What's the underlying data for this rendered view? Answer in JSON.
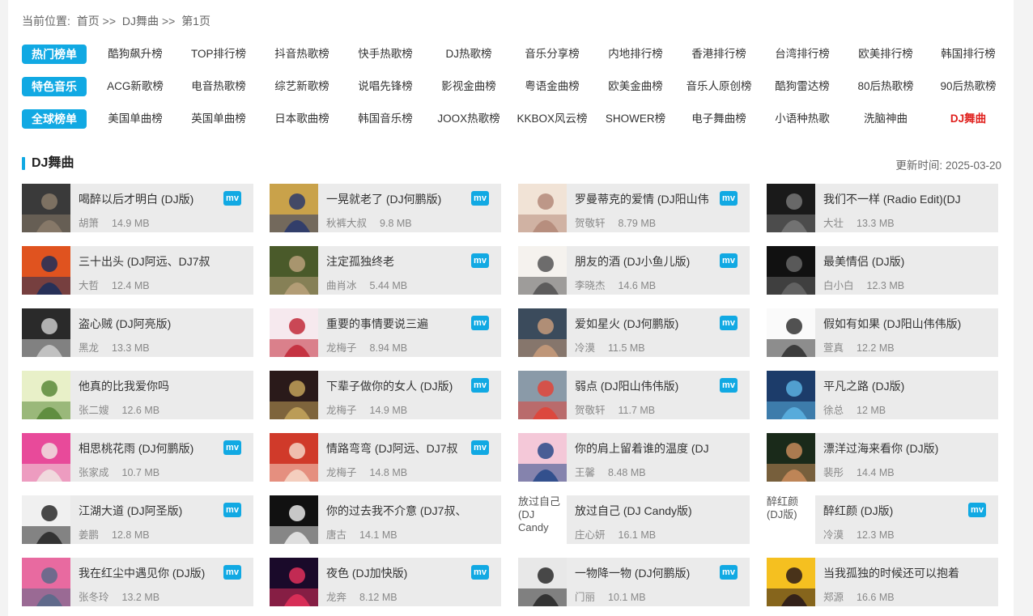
{
  "breadcrumb": {
    "prefix": "当前位置:",
    "home": "首页",
    "sep1": ">>",
    "section": "DJ舞曲",
    "sep2": ">>",
    "page": "第1页"
  },
  "categories": [
    {
      "badge": "热门榜单",
      "items": [
        "酷狗飙升榜",
        "TOP排行榜",
        "抖音热歌榜",
        "快手热歌榜",
        "DJ热歌榜",
        "音乐分享榜",
        "内地排行榜",
        "香港排行榜",
        "台湾排行榜",
        "欧美排行榜",
        "韩国排行榜"
      ]
    },
    {
      "badge": "特色音乐",
      "items": [
        "ACG新歌榜",
        "电音热歌榜",
        "综艺新歌榜",
        "说唱先锋榜",
        "影视金曲榜",
        "粤语金曲榜",
        "欧美金曲榜",
        "音乐人原创榜",
        "酷狗雷达榜",
        "80后热歌榜",
        "90后热歌榜"
      ]
    },
    {
      "badge": "全球榜单",
      "items": [
        "美国单曲榜",
        "英国单曲榜",
        "日本歌曲榜",
        "韩国音乐榜",
        "JOOX热歌榜",
        "KKBOX风云榜",
        "SHOWER榜",
        "电子舞曲榜",
        "小语种热歌",
        "洗脑神曲",
        "DJ舞曲"
      ]
    }
  ],
  "active_category": "DJ舞曲",
  "section": {
    "title": "DJ舞曲",
    "update_label": "更新时间:",
    "update_date": "2025-03-20"
  },
  "mv_label": "mv",
  "colors": {
    "accent": "#11a9e3",
    "active": "#e0201d",
    "card_bg": "#ebebeb"
  },
  "songs": [
    {
      "title": "喝醉以后才明白 (DJ版)",
      "artist": "胡箫",
      "size": "14.9 MB",
      "mv": true
    },
    {
      "title": "一晃就老了 (DJ何鹏版)",
      "artist": "秋裤大叔",
      "size": "9.8 MB",
      "mv": true
    },
    {
      "title": "罗曼蒂克的爱情 (DJ阳山伟",
      "artist": "贺敬轩",
      "size": "8.79 MB",
      "mv": true
    },
    {
      "title": "我们不一样 (Radio Edit)(DJ",
      "artist": "大壮",
      "size": "13.3 MB",
      "mv": false
    },
    {
      "title": "三十出头 (DJ阿远、DJ7叔",
      "artist": "大哲",
      "size": "12.4 MB",
      "mv": false
    },
    {
      "title": "注定孤独终老",
      "artist": "曲肖冰",
      "size": "5.44 MB",
      "mv": true
    },
    {
      "title": "朋友的酒 (DJ小鱼儿版)",
      "artist": "李晓杰",
      "size": "14.6 MB",
      "mv": true
    },
    {
      "title": "最美情侣 (DJ版)",
      "artist": "白小白",
      "size": "12.3 MB",
      "mv": false
    },
    {
      "title": "盗心贼 (DJ阿亮版)",
      "artist": "黑龙",
      "size": "13.3 MB",
      "mv": false
    },
    {
      "title": "重要的事情要说三遍",
      "artist": "龙梅子",
      "size": "8.94 MB",
      "mv": true
    },
    {
      "title": "爱如星火 (DJ何鹏版)",
      "artist": "冷漠",
      "size": "11.5 MB",
      "mv": true
    },
    {
      "title": "假如有如果 (DJ阳山伟伟版)",
      "artist": "萱真",
      "size": "12.2 MB",
      "mv": false
    },
    {
      "title": "他真的比我爱你吗",
      "artist": "张二嫂",
      "size": "12.6 MB",
      "mv": false
    },
    {
      "title": "下辈子做你的女人 (DJ版)",
      "artist": "龙梅子",
      "size": "14.9 MB",
      "mv": true
    },
    {
      "title": "弱点 (DJ阳山伟伟版)",
      "artist": "贺敬轩",
      "size": "11.7 MB",
      "mv": true
    },
    {
      "title": "平凡之路 (DJ版)",
      "artist": "徐总",
      "size": "12 MB",
      "mv": false
    },
    {
      "title": "相思桃花雨 (DJ何鹏版)",
      "artist": "张家成",
      "size": "10.7 MB",
      "mv": true
    },
    {
      "title": "情路弯弯 (DJ阿远、DJ7叔",
      "artist": "龙梅子",
      "size": "14.8 MB",
      "mv": true
    },
    {
      "title": "你的肩上留着谁的温度 (DJ",
      "artist": "王馨",
      "size": "8.48 MB",
      "mv": false
    },
    {
      "title": "漂洋过海来看你 (DJ版)",
      "artist": "裴彤",
      "size": "14.4 MB",
      "mv": false
    },
    {
      "title": "江湖大道 (DJ阿圣版)",
      "artist": "姜鹏",
      "size": "12.8 MB",
      "mv": true
    },
    {
      "title": "你的过去我不介意 (DJ7叔、",
      "artist": "唐古",
      "size": "14.1 MB",
      "mv": false
    },
    {
      "title": "放过自己 (DJ Candy版)",
      "artist": "庄心妍",
      "size": "16.1 MB",
      "mv": false,
      "broken_cover": "放过自己 (DJ Candy"
    },
    {
      "title": "醉红颜 (DJ版)",
      "artist": "冷漠",
      "size": "12.3 MB",
      "mv": true,
      "broken_cover": "醉红颜 (DJ版)"
    },
    {
      "title": "我在红尘中遇见你 (DJ版)",
      "artist": "张冬玲",
      "size": "13.2 MB",
      "mv": true
    },
    {
      "title": "夜色 (DJ加快版)",
      "artist": "龙奔",
      "size": "8.12 MB",
      "mv": true
    },
    {
      "title": "一物降一物 (DJ何鹏版)",
      "artist": "门丽",
      "size": "10.1 MB",
      "mv": true
    },
    {
      "title": "当我孤独的时候还可以抱着",
      "artist": "郑源",
      "size": "16.6 MB",
      "mv": false
    }
  ]
}
